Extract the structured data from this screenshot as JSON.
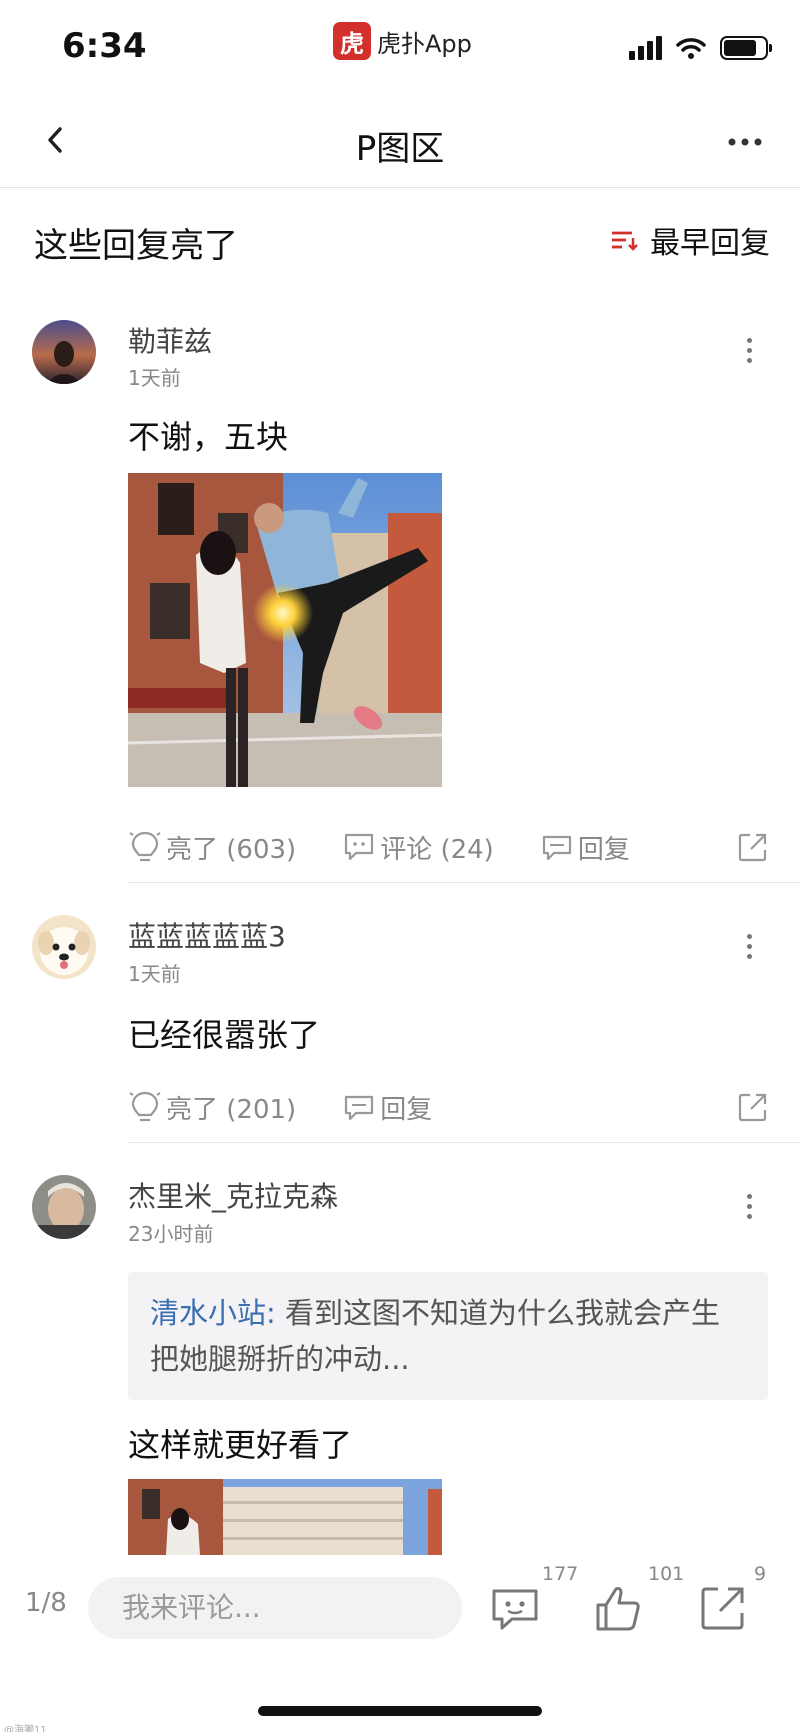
{
  "status_bar": {
    "time": "6:34",
    "app_logo_char": "虎",
    "app_name": "虎扑App"
  },
  "nav": {
    "title": "P图区"
  },
  "section": {
    "title": "这些回复亮了",
    "sort_label": "最早回复"
  },
  "replies": [
    {
      "user": "勒菲兹",
      "time": "1天前",
      "text": "不谢，五块",
      "actions": {
        "light": "亮了 (603)",
        "comment": "评论 (24)",
        "reply": "回复"
      }
    },
    {
      "user": "蓝蓝蓝蓝蓝3",
      "time": "1天前",
      "text": "已经很嚣张了",
      "actions": {
        "light": "亮了 (201)",
        "reply": "回复"
      }
    },
    {
      "user": "杰里米_克拉克森",
      "time": "23小时前",
      "quote": {
        "author": "清水小站:",
        "text": " 看到这图不知道为什么我就会产生把她腿掰折的冲动..."
      },
      "text": "这样就更好看了"
    }
  ],
  "bottom_bar": {
    "page": "1/8",
    "input_placeholder": "我来评论...",
    "comment_count": "177",
    "like_count": "101",
    "share_count": "9",
    "watermark": "@海獭11"
  },
  "colors": {
    "accent_red": "#d3302c",
    "link_blue": "#3a6fb0"
  }
}
